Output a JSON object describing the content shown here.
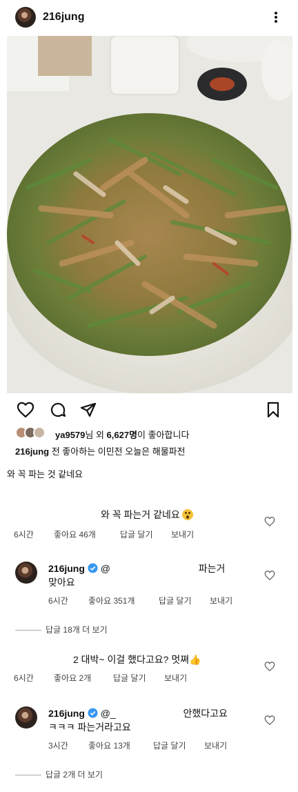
{
  "post": {
    "username": "216jung",
    "more_icon": "more-vertical-icon"
  },
  "actions": {
    "like_icon": "heart-icon",
    "comment_icon": "comment-icon",
    "share_icon": "send-icon",
    "save_icon": "bookmark-icon"
  },
  "likes": {
    "user": "ya9579",
    "text_mid": "님 외 ",
    "count": "6,627명",
    "text_end": "이 좋아합니다"
  },
  "caption": {
    "username": "216jung",
    "text": " 전 좋아하는 이민전 오늘은 해물파전"
  },
  "note": "와 꼭 파는 것 같네요",
  "comments": [
    {
      "text": "와 꼭 파는거 같네요",
      "emoji": "😮",
      "time": "6시간",
      "likes": "좋아요 46개",
      "reply": "답글 달기",
      "send": "보내기"
    },
    {
      "username": "216jung",
      "mention": "@",
      "text_end": "파는거",
      "line2": "맞아요",
      "time": "6시간",
      "likes": "좋아요 351개",
      "reply": "답글 달기",
      "send": "보내기",
      "more_replies": "답글 18개 더 보기"
    },
    {
      "text": "2 대박~  이걸 했다고요? 멋쪄",
      "emoji": "👍",
      "time": "6시간",
      "likes": "좋아요 2개",
      "reply": "답글 달기",
      "send": "보내기"
    },
    {
      "username": "216jung",
      "mention": "@_",
      "text_end": "안했다고요",
      "line2": "ㅋㅋㅋ 파는거라고요",
      "time": "3시간",
      "likes": "좋아요 13개",
      "reply": "답글 달기",
      "send": "보내기",
      "more_replies": "답글 2개 더 보기"
    }
  ]
}
